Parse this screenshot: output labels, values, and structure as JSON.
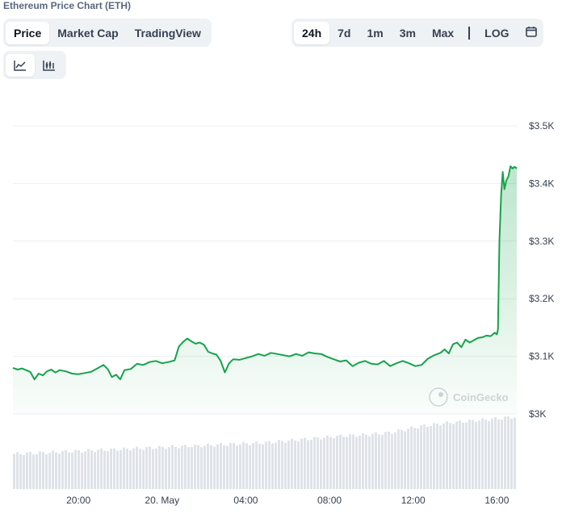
{
  "page_title": "Ethereum Price Chart (ETH)",
  "type_tabs": [
    "Price",
    "Market Cap",
    "TradingView"
  ],
  "range_tabs": [
    "24h",
    "7d",
    "1m",
    "3m",
    "Max"
  ],
  "log_label": "LOG",
  "icons": {
    "calendar": "calendar-icon",
    "line_view": "line-chart-icon",
    "ohlc_view": "candlestick-chart-icon"
  },
  "watermark": "CoinGecko",
  "colors": {
    "line": "#16a34a",
    "area_top": "#c8ecd3",
    "volume": "#dfe3e8"
  },
  "chart_data": {
    "type": "line",
    "title": "",
    "ylim": [
      3000,
      3500
    ],
    "y_ticks": [
      3000,
      3100,
      3200,
      3300,
      3400,
      3500
    ],
    "y_tick_labels": [
      "$3K",
      "$3.1K",
      "$3.2K",
      "$3.3K",
      "$3.4K",
      "$3.5K"
    ],
    "x_tick_labels": [
      "20:00",
      "20. May",
      "04:00",
      "08:00",
      "12:00",
      "16:00"
    ],
    "x_tick_hours": [
      20,
      24,
      28,
      32,
      36,
      40
    ],
    "x_range_hours": [
      16.87,
      40.95
    ],
    "grid": true,
    "series": [
      {
        "values": [
          [
            16.87,
            3080
          ],
          [
            17.1,
            3077
          ],
          [
            17.3,
            3079
          ],
          [
            17.5,
            3076
          ],
          [
            17.7,
            3073
          ],
          [
            17.9,
            3060
          ],
          [
            18.1,
            3070
          ],
          [
            18.3,
            3067
          ],
          [
            18.5,
            3074
          ],
          [
            18.7,
            3077
          ],
          [
            18.9,
            3072
          ],
          [
            19.1,
            3076
          ],
          [
            19.4,
            3074
          ],
          [
            19.7,
            3070
          ],
          [
            20.0,
            3069
          ],
          [
            20.3,
            3071
          ],
          [
            20.6,
            3073
          ],
          [
            20.9,
            3079
          ],
          [
            21.2,
            3085
          ],
          [
            21.4,
            3078
          ],
          [
            21.6,
            3064
          ],
          [
            21.8,
            3068
          ],
          [
            22.0,
            3060
          ],
          [
            22.2,
            3076
          ],
          [
            22.5,
            3078
          ],
          [
            22.8,
            3087
          ],
          [
            23.1,
            3085
          ],
          [
            23.4,
            3090
          ],
          [
            23.7,
            3092
          ],
          [
            24.0,
            3088
          ],
          [
            24.3,
            3090
          ],
          [
            24.6,
            3093
          ],
          [
            24.8,
            3117
          ],
          [
            25.0,
            3125
          ],
          [
            25.2,
            3131
          ],
          [
            25.4,
            3126
          ],
          [
            25.6,
            3122
          ],
          [
            25.8,
            3124
          ],
          [
            26.0,
            3120
          ],
          [
            26.2,
            3108
          ],
          [
            26.4,
            3105
          ],
          [
            26.6,
            3103
          ],
          [
            26.8,
            3092
          ],
          [
            27.0,
            3072
          ],
          [
            27.2,
            3088
          ],
          [
            27.4,
            3095
          ],
          [
            27.7,
            3094
          ],
          [
            28.0,
            3097
          ],
          [
            28.3,
            3100
          ],
          [
            28.6,
            3104
          ],
          [
            28.9,
            3101
          ],
          [
            29.2,
            3106
          ],
          [
            29.5,
            3104
          ],
          [
            29.8,
            3102
          ],
          [
            30.1,
            3100
          ],
          [
            30.4,
            3104
          ],
          [
            30.7,
            3101
          ],
          [
            31.0,
            3107
          ],
          [
            31.3,
            3105
          ],
          [
            31.6,
            3104
          ],
          [
            31.9,
            3099
          ],
          [
            32.2,
            3095
          ],
          [
            32.5,
            3091
          ],
          [
            32.8,
            3093
          ],
          [
            33.1,
            3083
          ],
          [
            33.4,
            3089
          ],
          [
            33.7,
            3092
          ],
          [
            34.0,
            3087
          ],
          [
            34.3,
            3086
          ],
          [
            34.6,
            3092
          ],
          [
            34.9,
            3083
          ],
          [
            35.2,
            3088
          ],
          [
            35.5,
            3092
          ],
          [
            35.8,
            3088
          ],
          [
            36.1,
            3083
          ],
          [
            36.4,
            3085
          ],
          [
            36.7,
            3096
          ],
          [
            37.0,
            3102
          ],
          [
            37.3,
            3106
          ],
          [
            37.5,
            3112
          ],
          [
            37.7,
            3105
          ],
          [
            37.9,
            3121
          ],
          [
            38.1,
            3124
          ],
          [
            38.3,
            3116
          ],
          [
            38.5,
            3129
          ],
          [
            38.7,
            3124
          ],
          [
            38.9,
            3128
          ],
          [
            39.1,
            3132
          ],
          [
            39.3,
            3133
          ],
          [
            39.5,
            3136
          ],
          [
            39.7,
            3135
          ],
          [
            39.9,
            3141
          ],
          [
            40.0,
            3138
          ],
          [
            40.05,
            3147
          ],
          [
            40.12,
            3300
          ],
          [
            40.2,
            3380
          ],
          [
            40.28,
            3420
          ],
          [
            40.36,
            3390
          ],
          [
            40.45,
            3405
          ],
          [
            40.55,
            3412
          ],
          [
            40.65,
            3430
          ],
          [
            40.75,
            3426
          ],
          [
            40.85,
            3429
          ],
          [
            40.95,
            3426
          ]
        ]
      }
    ],
    "volume": [
      0.31,
      0.32,
      0.33,
      0.34,
      0.35,
      0.36,
      0.37,
      0.38,
      0.39,
      0.4,
      0.41,
      0.43,
      0.45,
      0.47,
      0.48,
      0.5,
      0.55,
      0.58,
      0.6,
      0.62,
      0.64
    ]
  }
}
